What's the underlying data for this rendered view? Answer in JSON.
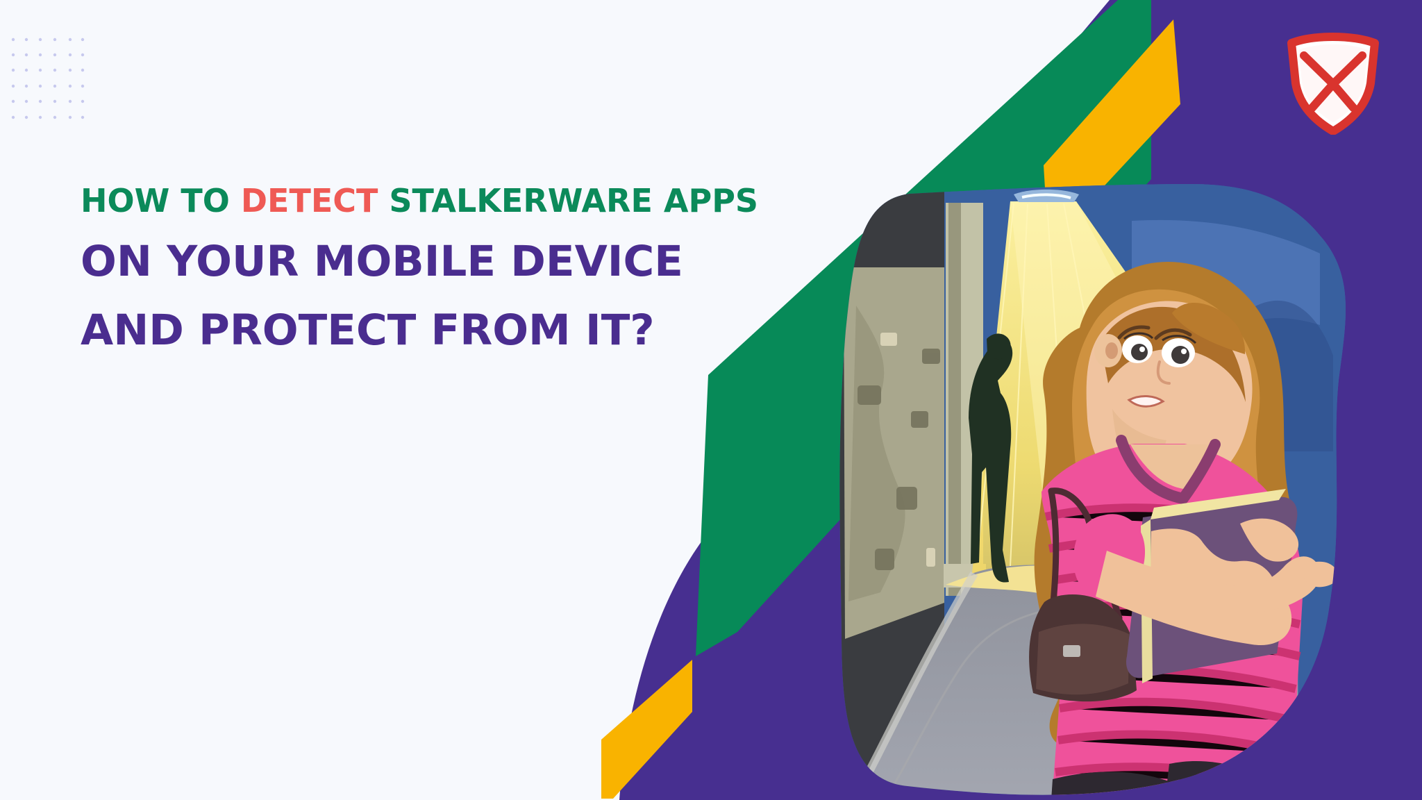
{
  "headline": {
    "line1_prefix": "HOW TO ",
    "line1_highlight": "DETECT",
    "line1_suffix": " STALKERWARE APPS",
    "line2": "ON YOUR MOBILE DEVICE",
    "line3": "AND PROTECT FROM IT?"
  },
  "colors": {
    "background": "#f7f9fd",
    "headline_green": "#0b8a5a",
    "headline_red": "#ef5a55",
    "headline_purple": "#4a2d8f",
    "brand_purple": "#472f90",
    "brand_green": "#078a58",
    "brand_yellow": "#f9b300",
    "shirt_pink": "#ee4d99"
  },
  "icons": {
    "logo": "shield-envelope-logo",
    "dot_grid": "decorative-dot-grid",
    "illustration": "worried-girl-stalker-illustration"
  }
}
